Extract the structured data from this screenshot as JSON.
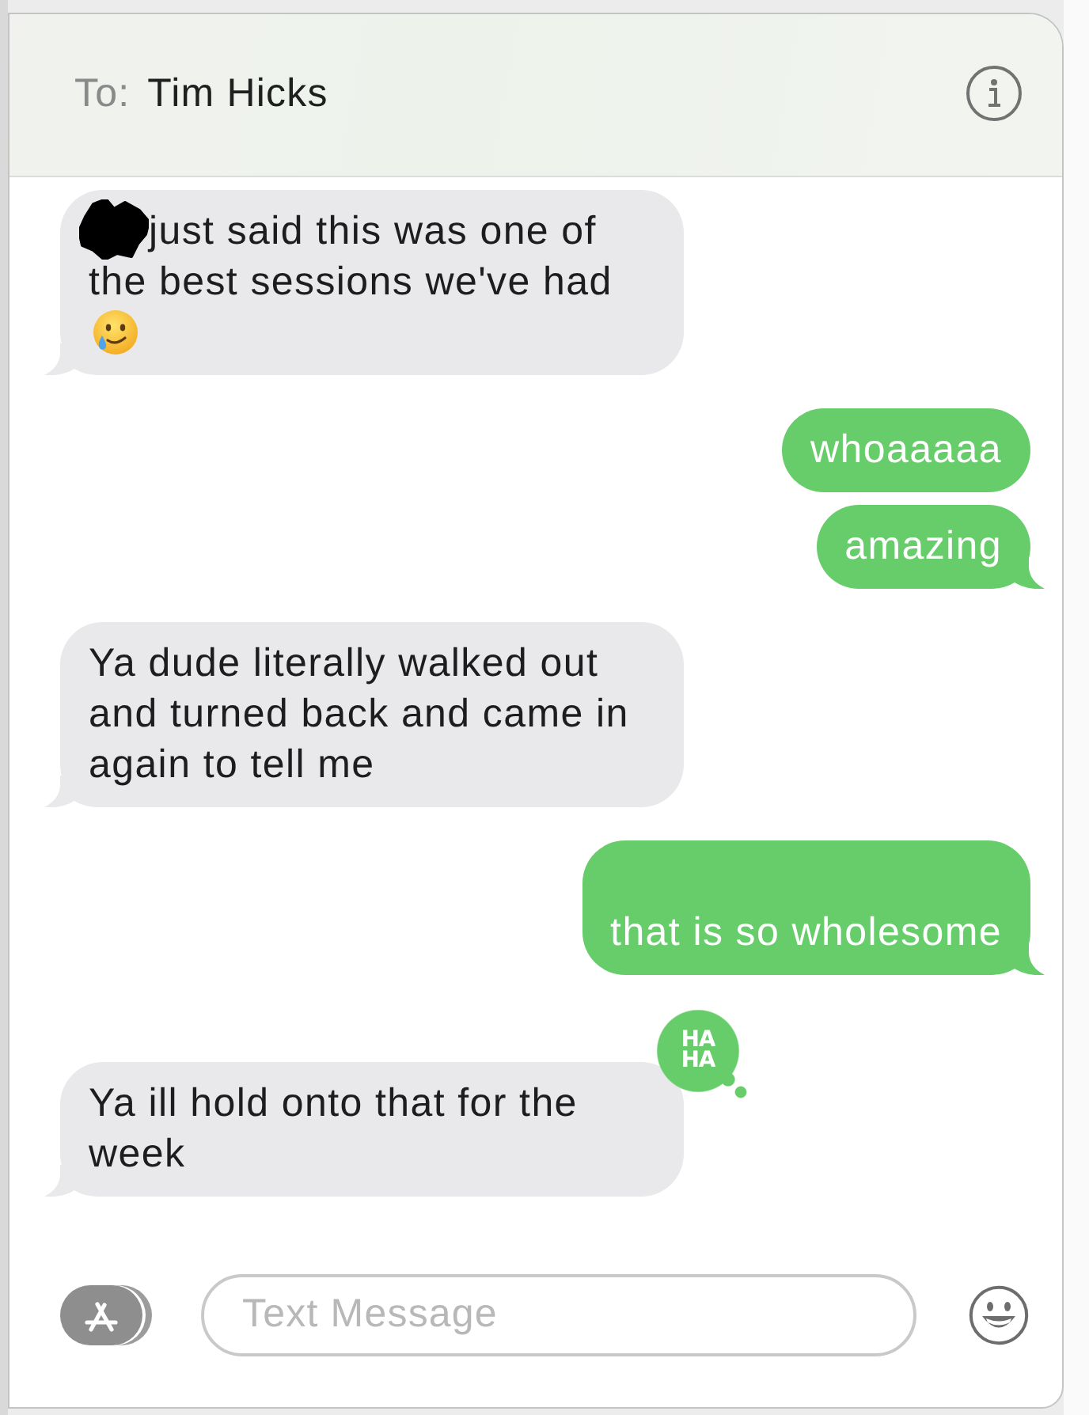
{
  "header": {
    "to_label": "To:",
    "recipient": "Tim Hicks"
  },
  "messages": [
    {
      "kind": "received",
      "text": "just said this was one of the best sessions we've had",
      "redacted": true,
      "emoji": true,
      "tail": true
    },
    {
      "kind": "sent",
      "text": "whoaaaaa",
      "redacted": false,
      "emoji": false,
      "tail": false
    },
    {
      "kind": "sent",
      "text": "amazing",
      "redacted": false,
      "emoji": false,
      "tail": true
    },
    {
      "kind": "received",
      "text": "Ya dude literally walked out and turned back and came in again to tell me",
      "redacted": false,
      "emoji": false,
      "tail": true
    },
    {
      "kind": "sent",
      "text": "\nthat is so wholesome",
      "redacted": false,
      "emoji": false,
      "tail": true
    },
    {
      "kind": "received",
      "text": "Ya ill hold onto that for the week",
      "redacted": false,
      "emoji": false,
      "tail": true,
      "reaction": "HA HA"
    }
  ],
  "compose": {
    "placeholder": "Text Message"
  }
}
